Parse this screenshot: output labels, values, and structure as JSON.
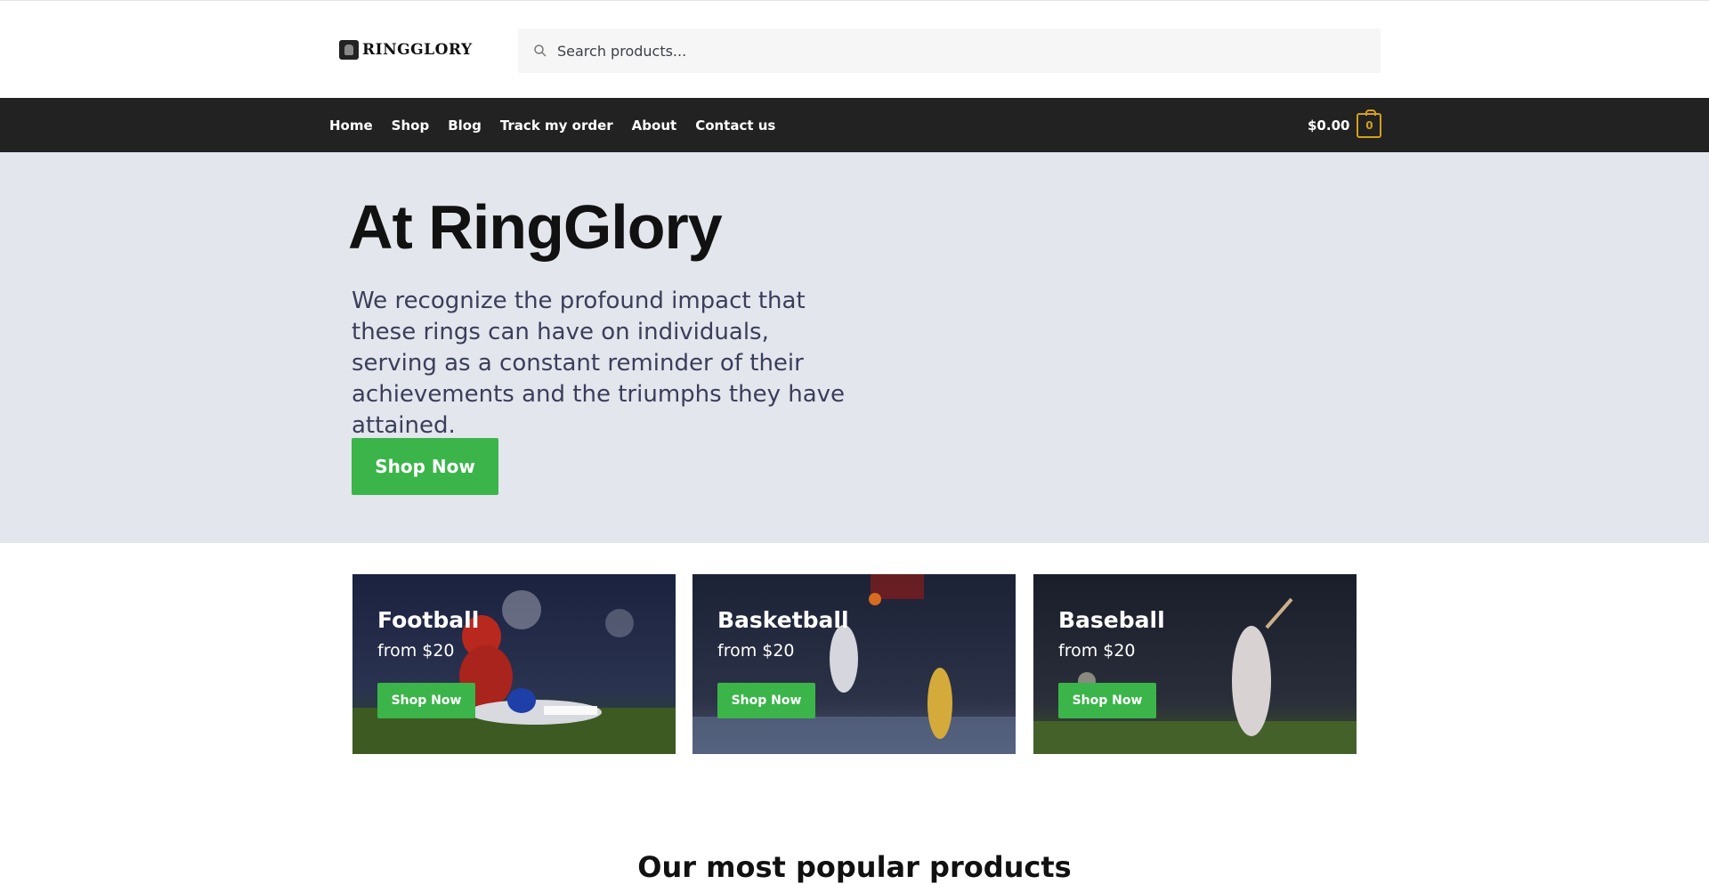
{
  "header": {
    "logo_text": "RINGGLORY",
    "search": {
      "placeholder": "Search products..."
    }
  },
  "nav": {
    "items": [
      "Home",
      "Shop",
      "Blog",
      "Track my order",
      "About",
      "Contact us"
    ],
    "cart": {
      "total": "$0.00",
      "count": "0"
    }
  },
  "hero": {
    "title": "At RingGlory",
    "text": "We recognize the profound impact that these rings can have on individuals, serving as a constant reminder of their achievements and the triumphs they have attained.",
    "button_label": "Shop Now"
  },
  "categories": [
    {
      "title": "Football",
      "subtitle": "from $20",
      "button_label": "Shop Now"
    },
    {
      "title": "Basketball",
      "subtitle": "from $20",
      "button_label": "Shop Now"
    },
    {
      "title": "Baseball",
      "subtitle": "from $20",
      "button_label": "Shop Now"
    }
  ],
  "popular": {
    "title": "Our most popular products"
  },
  "colors": {
    "accent_green": "#3bb54a",
    "nav_bg": "#222222",
    "hero_bg": "#e3e6ec",
    "cart_badge": "#d4a017"
  }
}
